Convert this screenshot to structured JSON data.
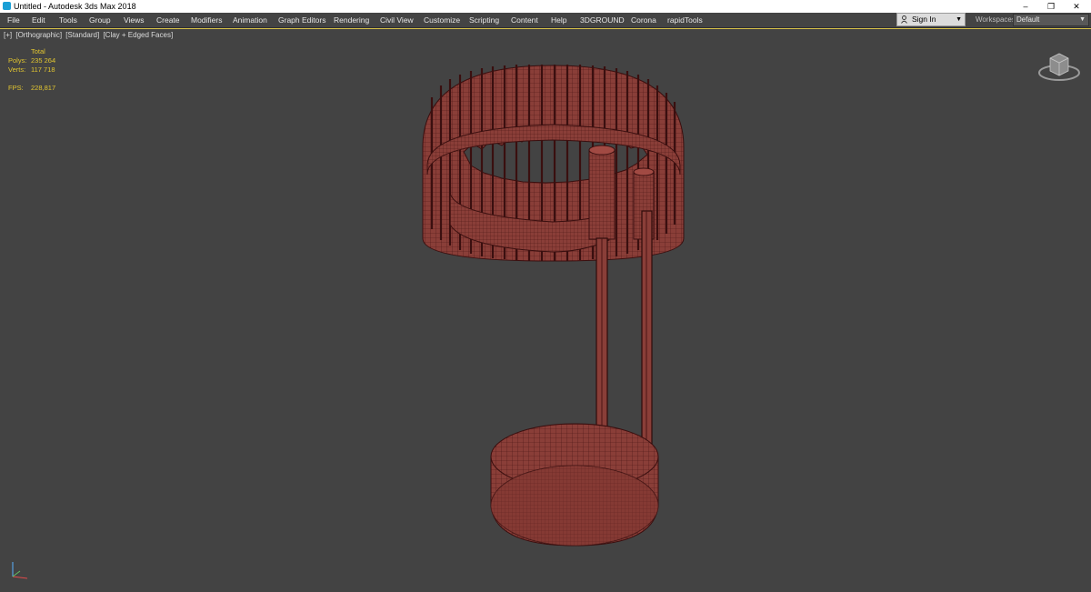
{
  "window": {
    "title": "Untitled - Autodesk 3ds Max 2018",
    "controls": {
      "minimize": "–",
      "restore": "❐",
      "close": "✕"
    }
  },
  "menu": [
    "File",
    "Edit",
    "Tools",
    "Group",
    "Views",
    "Create",
    "Modifiers",
    "Animation",
    "Graph Editors",
    "Rendering",
    "Civil View",
    "Customize",
    "Scripting",
    "Content",
    "Help",
    "3DGROUND",
    "Corona",
    "rapidTools"
  ],
  "account": {
    "sign_in": "Sign In"
  },
  "workspace": {
    "label": "Workspaces:",
    "value": "Default"
  },
  "viewport": {
    "labels": [
      "[+]",
      "[Orthographic]",
      "[Standard]",
      "[Clay + Edged Faces]"
    ],
    "stats": {
      "header": "Total",
      "polys_label": "Polys:",
      "polys": "235 264",
      "verts_label": "Verts:",
      "verts": "117 718",
      "fps_label": "FPS:",
      "fps": "228,817"
    }
  },
  "colors": {
    "mesh": "#8a3e38",
    "wire": "#4a1414",
    "viewport_bg": "#434343",
    "stats_text": "#e1c530",
    "active_border": "#d8c24a"
  }
}
